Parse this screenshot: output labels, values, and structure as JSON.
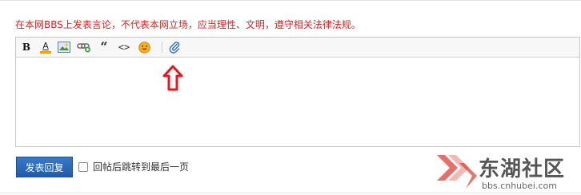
{
  "notice": "在本网BBS上发表言论，不代表本网立场，应当理性、文明，遵守相关法律法规。",
  "toolbar": {
    "bold_label": "B",
    "font_color_label": "A",
    "quote_label": "“",
    "code_label": "<>"
  },
  "reply": {
    "submit_label": "发表回复",
    "jump_label": "回帖后跳转到最后一页",
    "jump_checked": false
  },
  "watermark": {
    "brand": "东湖社区",
    "url": "bbs.cnhubei.com"
  },
  "colors": {
    "notice": "#e02020",
    "button": "#2b68b8",
    "arrow": "#e8171d",
    "font_color_bar": "#f0a000"
  }
}
